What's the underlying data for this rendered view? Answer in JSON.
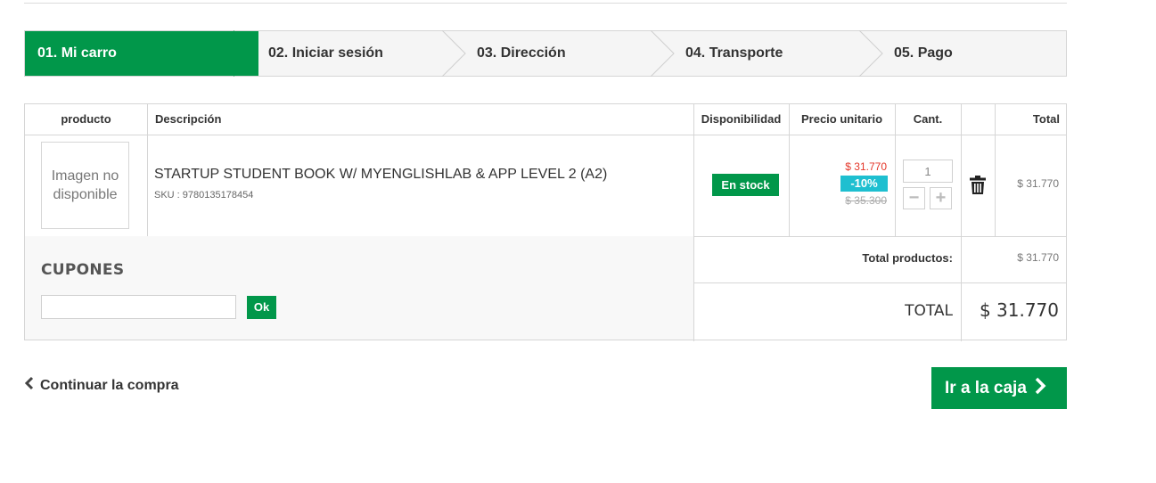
{
  "steps": [
    {
      "label": "01. Mi carro"
    },
    {
      "label": "02. Iniciar sesión"
    },
    {
      "label": "03. Dirección"
    },
    {
      "label": "04. Transporte"
    },
    {
      "label": "05. Pago"
    }
  ],
  "table": {
    "headers": {
      "product": "producto",
      "description": "Descripción",
      "availability": "Disponibilidad",
      "unit_price": "Precio unitario",
      "qty": "Cant.",
      "total": "Total"
    },
    "item": {
      "image_placeholder": "Imagen no disponible",
      "name": "STARTUP STUDENT BOOK W/ MYENGLISHLAB & APP LEVEL 2 (A2)",
      "sku": "SKU : 9780135178454",
      "availability": "En stock",
      "price_new": "$ 31.770",
      "discount": "-10%",
      "price_old": "$ 35.300",
      "quantity": "1",
      "total": "$ 31.770"
    }
  },
  "coupons": {
    "title": "CUPONES",
    "input_value": "",
    "ok_label": "Ok"
  },
  "summary": {
    "products_label": "Total productos:",
    "products_value": "$ 31.770",
    "total_label": "TOTAL",
    "total_value": "$ 31.770"
  },
  "actions": {
    "continue_label": "Continuar la compra",
    "checkout_label": "Ir a la caja"
  },
  "colors": {
    "brand_green": "#01974a",
    "discount_cyan": "#1ebfd0",
    "price_red": "#e4372a"
  }
}
